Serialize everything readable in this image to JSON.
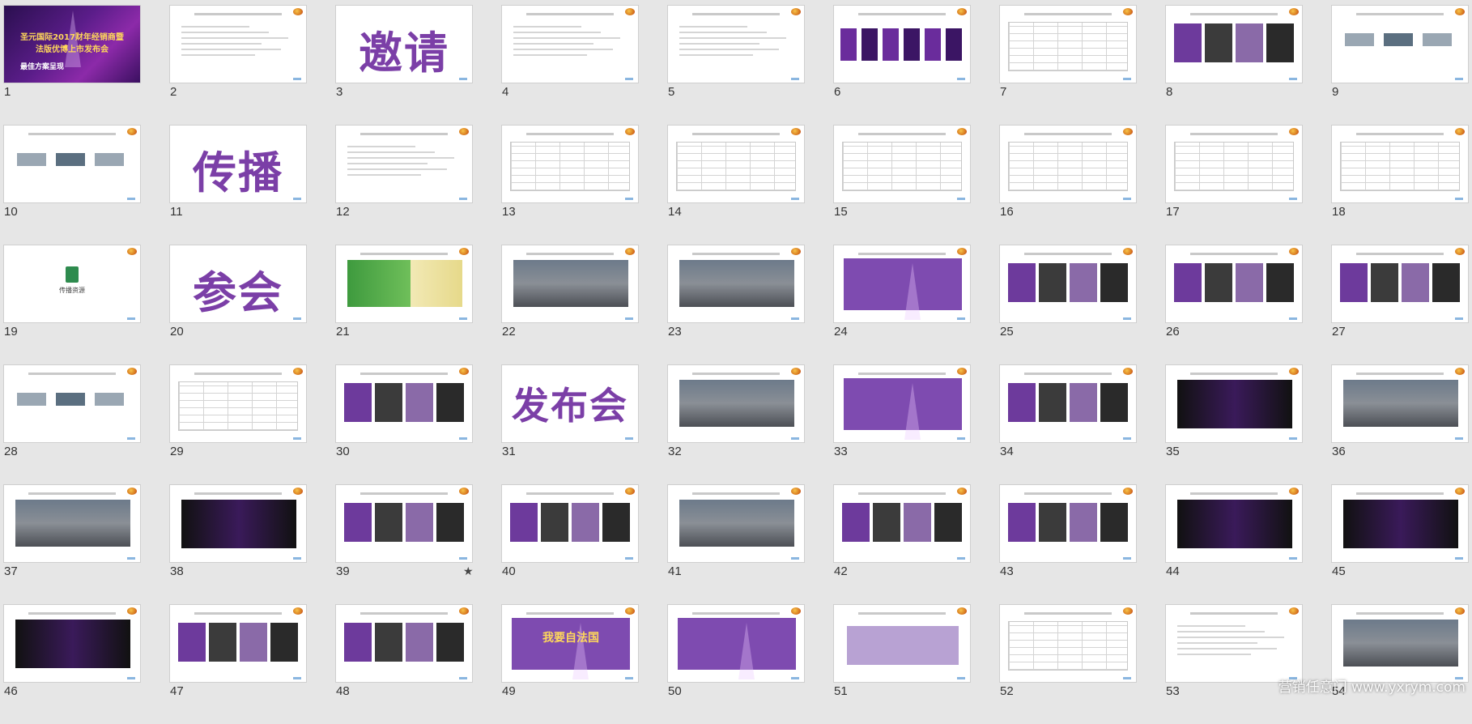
{
  "window": {
    "title": ""
  },
  "slides": [
    {
      "num": "1",
      "kind": "cover",
      "title": "圣元国际2017财年经销商暨法版优博上市发布会",
      "subtitle": "最佳方案呈现"
    },
    {
      "num": "2",
      "kind": "text"
    },
    {
      "num": "3",
      "kind": "word",
      "word": "邀请"
    },
    {
      "num": "4",
      "kind": "text"
    },
    {
      "num": "5",
      "kind": "text"
    },
    {
      "num": "6",
      "kind": "phones"
    },
    {
      "num": "7",
      "kind": "table"
    },
    {
      "num": "8",
      "kind": "images"
    },
    {
      "num": "9",
      "kind": "diagram"
    },
    {
      "num": "10",
      "kind": "diagram"
    },
    {
      "num": "11",
      "kind": "word",
      "word": "传播"
    },
    {
      "num": "12",
      "kind": "text"
    },
    {
      "num": "13",
      "kind": "table"
    },
    {
      "num": "14",
      "kind": "table"
    },
    {
      "num": "15",
      "kind": "table"
    },
    {
      "num": "16",
      "kind": "table"
    },
    {
      "num": "17",
      "kind": "table"
    },
    {
      "num": "18",
      "kind": "table"
    },
    {
      "num": "19",
      "kind": "file",
      "caption": "传播资源"
    },
    {
      "num": "20",
      "kind": "word",
      "word": "参会"
    },
    {
      "num": "21",
      "kind": "map"
    },
    {
      "num": "22",
      "kind": "photo"
    },
    {
      "num": "23",
      "kind": "photo"
    },
    {
      "num": "24",
      "kind": "purple"
    },
    {
      "num": "25",
      "kind": "images"
    },
    {
      "num": "26",
      "kind": "images"
    },
    {
      "num": "27",
      "kind": "images"
    },
    {
      "num": "28",
      "kind": "diagram"
    },
    {
      "num": "29",
      "kind": "table"
    },
    {
      "num": "30",
      "kind": "images"
    },
    {
      "num": "31",
      "kind": "word",
      "word": "发布会"
    },
    {
      "num": "32",
      "kind": "photo"
    },
    {
      "num": "33",
      "kind": "purple"
    },
    {
      "num": "34",
      "kind": "images"
    },
    {
      "num": "35",
      "kind": "dark"
    },
    {
      "num": "36",
      "kind": "photo"
    },
    {
      "num": "37",
      "kind": "photo"
    },
    {
      "num": "38",
      "kind": "dark"
    },
    {
      "num": "39",
      "kind": "images",
      "star": "★"
    },
    {
      "num": "40",
      "kind": "images"
    },
    {
      "num": "41",
      "kind": "photo"
    },
    {
      "num": "42",
      "kind": "images"
    },
    {
      "num": "43",
      "kind": "images"
    },
    {
      "num": "44",
      "kind": "dark"
    },
    {
      "num": "45",
      "kind": "dark"
    },
    {
      "num": "46",
      "kind": "dark"
    },
    {
      "num": "47",
      "kind": "images"
    },
    {
      "num": "48",
      "kind": "images"
    },
    {
      "num": "49",
      "kind": "purple",
      "cover_title": "我要自法国"
    },
    {
      "num": "50",
      "kind": "purple"
    },
    {
      "num": "51",
      "kind": "block"
    },
    {
      "num": "52",
      "kind": "table"
    },
    {
      "num": "53",
      "kind": "text"
    },
    {
      "num": "54",
      "kind": "photo"
    }
  ],
  "watermark": "营销任意门 www.yxrym.com",
  "colors": {
    "accent_purple": "#7b3fa7",
    "background": "#e6e6e6"
  }
}
